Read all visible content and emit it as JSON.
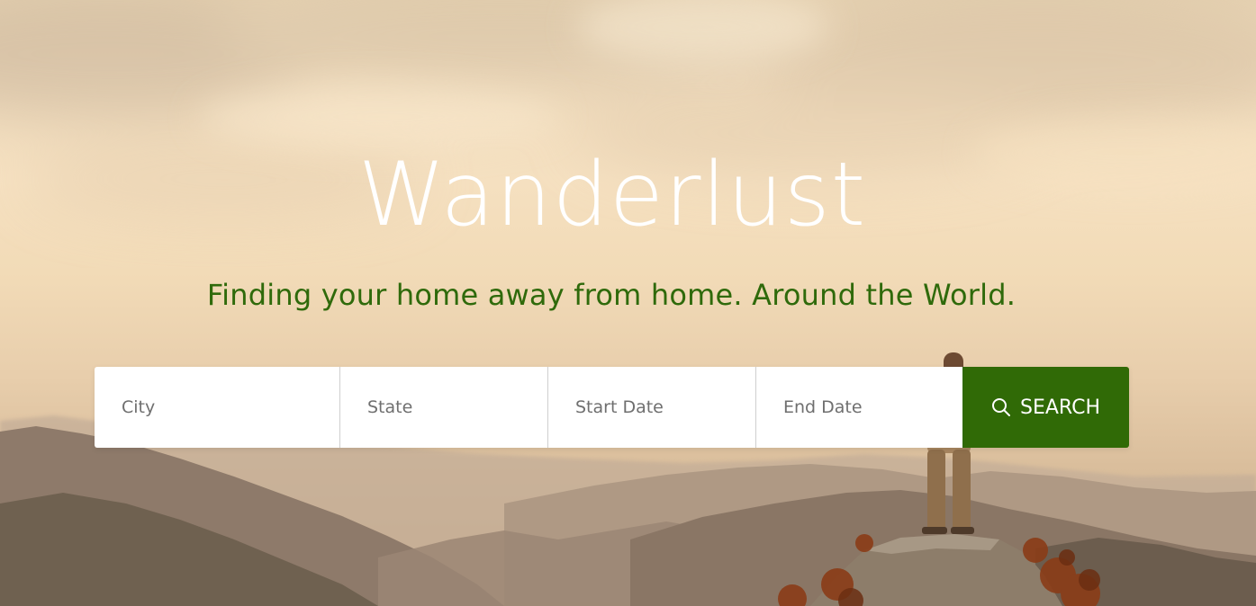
{
  "hero": {
    "title": "Wanderlust",
    "subtitle": "Finding your home away from home. Around the World."
  },
  "search": {
    "city_placeholder": "City",
    "state_placeholder": "State",
    "start_date_placeholder": "Start Date",
    "end_date_placeholder": "End Date",
    "button_label": "SEARCH",
    "button_icon": "search-icon"
  },
  "colors": {
    "accent_green": "#306a06",
    "subtitle_green": "#2f6a0b",
    "title_white": "#ffffff"
  }
}
